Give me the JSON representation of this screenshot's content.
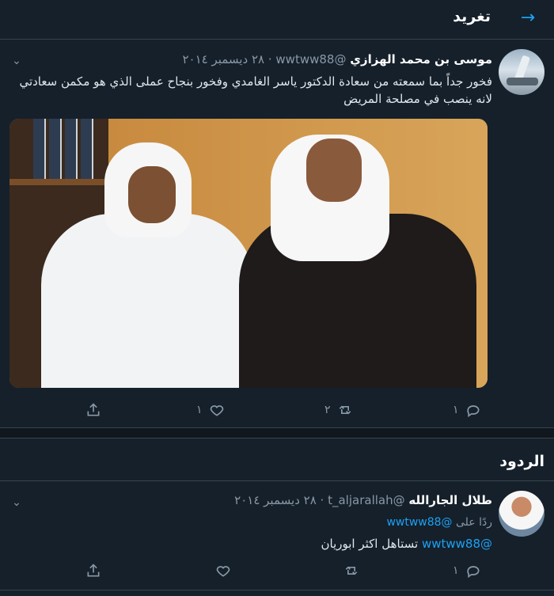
{
  "header": {
    "title": "تغريد",
    "back_arrow": "→"
  },
  "tweet": {
    "author_name": "موسى بن محمد الهزازي",
    "author_handle": "@wwtww88",
    "dot": "·",
    "date": "٢٨ ديسمبر ٢٠١٤",
    "text": "فخور جداً بما سمعته من سعادة الدكتور ياسر الغامدي وفخور بنجاح عملى الذي هو مكمن سعادتي لانه ينصب في مصلحة المريض",
    "actions": {
      "reply_count": "١",
      "retweet_count": "٢",
      "like_count": "١"
    }
  },
  "replies_section": {
    "title": "الردود"
  },
  "reply": {
    "author_name": "طلال الجارالله",
    "author_handle": "@t_aljarallah",
    "dot": "·",
    "date": "٢٨ ديسمبر ٢٠١٤",
    "replying_to_prefix": "ردًا على",
    "replying_to_handle": "@wwtww88",
    "mention": "@wwtww88",
    "text": "تستاهل اكثر ابوريان",
    "actions": {
      "reply_count": "١"
    }
  },
  "colors": {
    "background": "#15202b",
    "accent": "#1da1f2",
    "muted": "#8899a6",
    "border": "#38444d"
  }
}
